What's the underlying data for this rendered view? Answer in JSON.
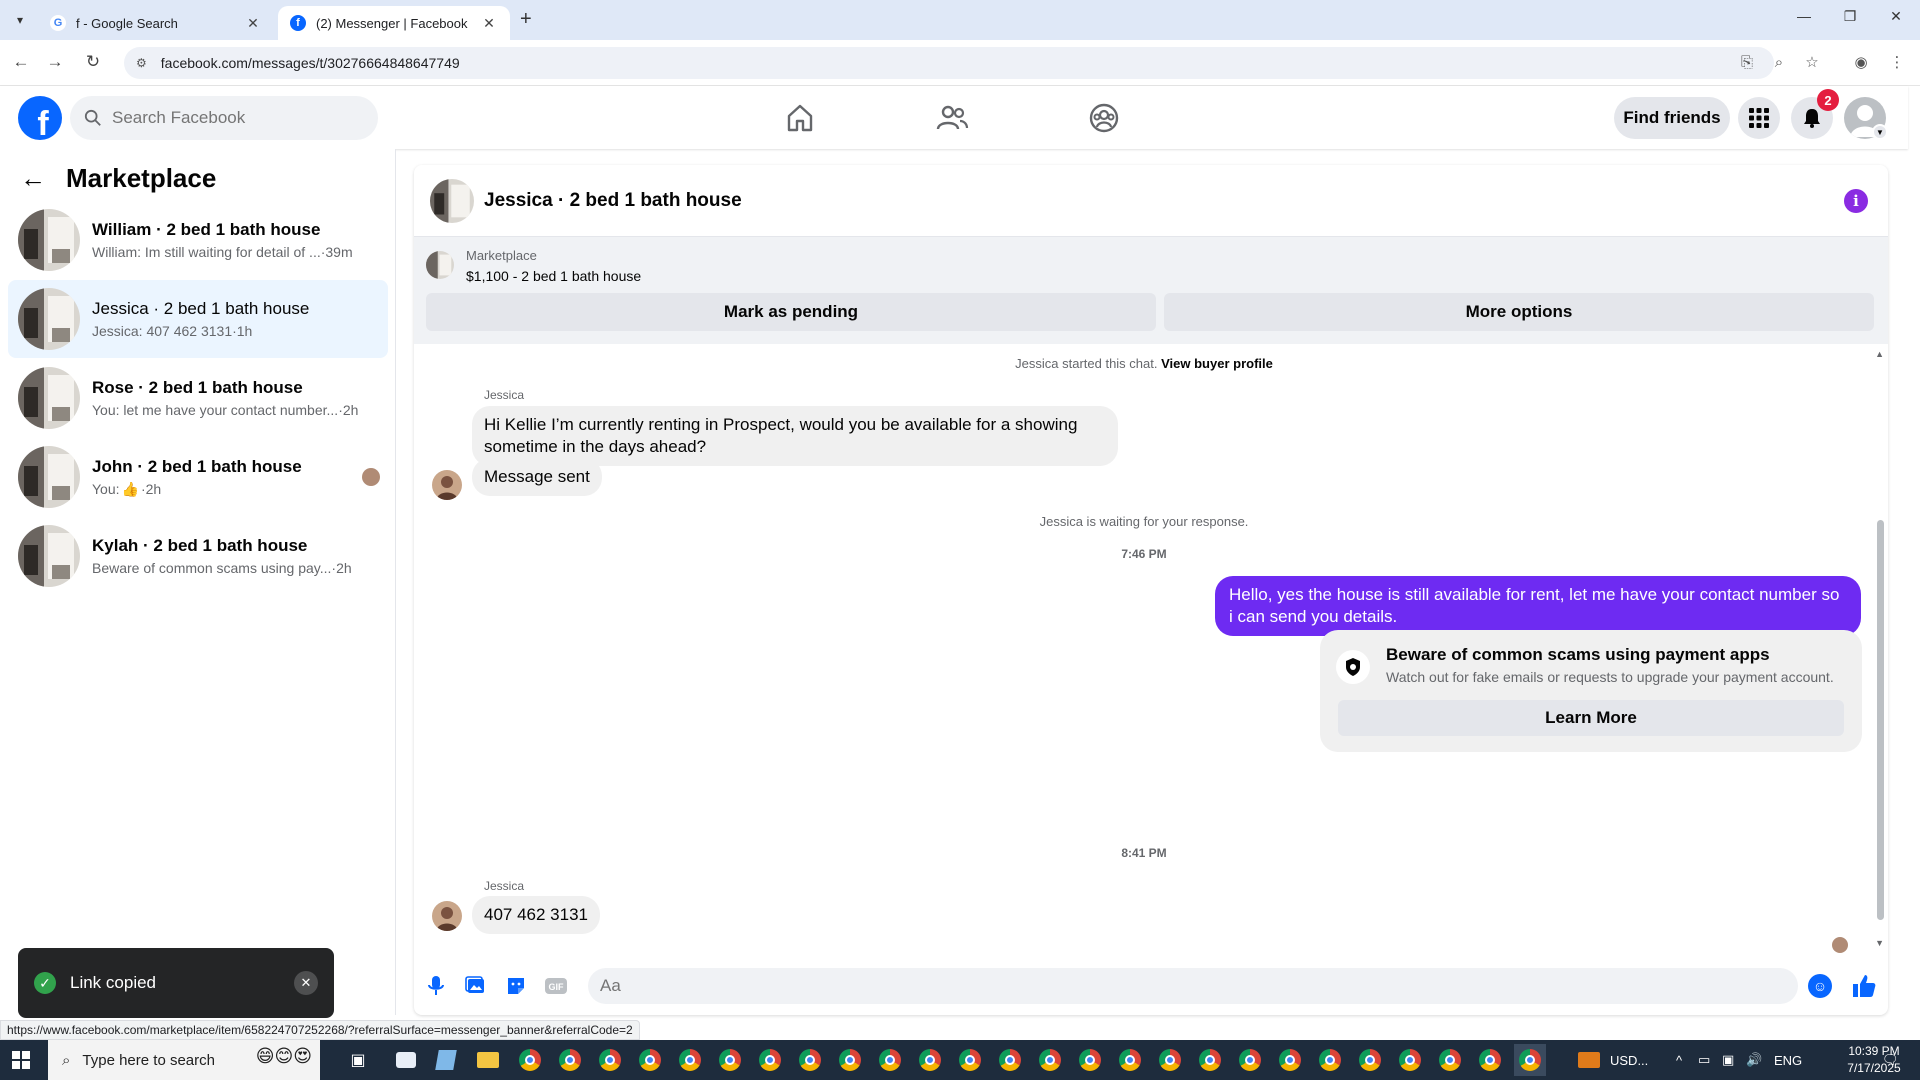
{
  "browser": {
    "tabs": [
      {
        "title": "f - Google Search",
        "active": false
      },
      {
        "title": "(2) Messenger | Facebook",
        "active": true
      }
    ],
    "url": "facebook.com/messages/t/30276664848647749",
    "status_url": "https://www.facebook.com/marketplace/item/658224707252268/?referralSurface=messenger_banner&referralCode=2"
  },
  "fb_header": {
    "search_placeholder": "Search Facebook",
    "find_friends": "Find friends",
    "notification_count": "2",
    "brand_color": "#0866ff"
  },
  "sidebar": {
    "title": "Marketplace",
    "conversations": [
      {
        "name": "William · 2 bed 1 bath house",
        "preview": "William: Im still waiting for detail of ...",
        "time": "·39m",
        "selected": false
      },
      {
        "name": "Jessica · 2 bed 1 bath house",
        "preview": "Jessica: 407 462 3131",
        "time": "·1h",
        "selected": true
      },
      {
        "name": "Rose · 2 bed 1 bath house",
        "preview": "You: let me have your contact number...",
        "time": "·2h",
        "selected": false
      },
      {
        "name": "John · 2 bed 1 bath house",
        "preview": "You: ",
        "time": "·2h",
        "selected": false
      },
      {
        "name": "Kylah · 2 bed 1 bath house",
        "preview": "Beware of common scams using pay...",
        "time": "·2h",
        "selected": false
      }
    ]
  },
  "toast": {
    "message": "Link copied"
  },
  "chat": {
    "title": "Jessica · 2 bed 1 bath house",
    "banner": {
      "label": "Marketplace",
      "listing": "$1,100 - 2 bed 1 bath house",
      "mark_pending": "Mark as pending",
      "more_options": "More options"
    },
    "started": "Jessica started this chat.",
    "view_profile": "View buyer profile",
    "sender1": "Jessica",
    "msg1": "Hi Kellie I’m currently renting in Prospect, would you be available for a showing sometime in the days ahead?",
    "msg2": "Message sent",
    "waiting": "Jessica is waiting for your response.",
    "time1": "7:46 PM",
    "reply": "Hello, yes the house is still available for rent, let me have your contact number so i can send you details.",
    "scam": {
      "title": "Beware of common scams using payment apps",
      "subtitle": "Watch out for fake emails or requests to upgrade your payment account.",
      "button": "Learn More"
    },
    "time2": "8:41 PM",
    "sender2": "Jessica",
    "msg3": "407 462 3131",
    "composer_placeholder": "Aa",
    "accent_color": "#6e2bf2"
  },
  "taskbar": {
    "search_placeholder": "Type here to search",
    "currency": "USD...",
    "lang": "ENG",
    "time": "10:39 PM",
    "date": "7/17/2025"
  }
}
